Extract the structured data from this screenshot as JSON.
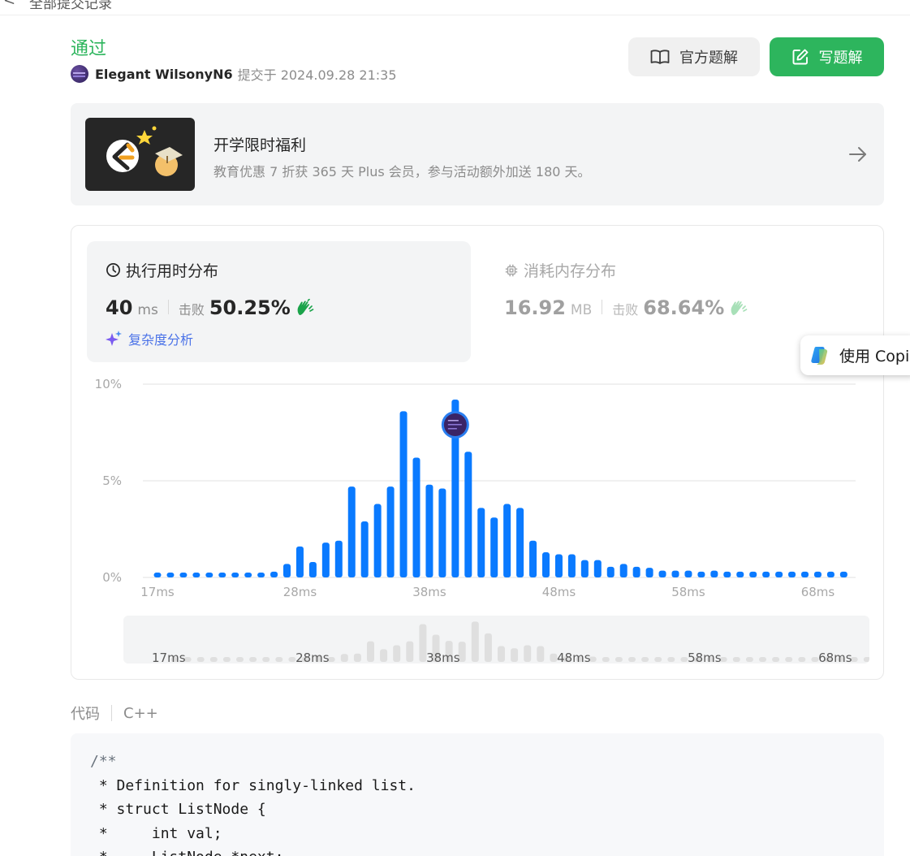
{
  "nav": {
    "back_label": "<",
    "breadcrumb": "全部提交记录"
  },
  "submission": {
    "status": "通过",
    "user": "Elegant WilsonyN6",
    "meta": "提交于 2024.09.28 21:35"
  },
  "actions": {
    "official_solution": "官方题解",
    "write_solution": "写题解"
  },
  "promo": {
    "title": "开学限时福利",
    "description": "教育优惠 7 折获 365 天 Plus 会员，参与活动额外加送 180 天。"
  },
  "runtime": {
    "title": "执行用时分布",
    "value": "40",
    "unit": "ms",
    "beat_label": "击败",
    "percent": "50.25%",
    "complexity_link": "复杂度分析"
  },
  "memory": {
    "title": "消耗内存分布",
    "value": "16.92",
    "unit": "MB",
    "beat_label": "击败",
    "percent": "68.64%"
  },
  "chart_data": {
    "type": "bar",
    "title": "执行用时分布",
    "xlabel": "",
    "ylabel": "",
    "ylim": [
      0,
      10
    ],
    "y_ticks": [
      "0%",
      "5%",
      "10%"
    ],
    "x_ticks": [
      "17ms",
      "28ms",
      "38ms",
      "48ms",
      "58ms",
      "68ms"
    ],
    "x": [
      17,
      18,
      19,
      20,
      21,
      22,
      23,
      24,
      25,
      26,
      27,
      28,
      29,
      30,
      31,
      32,
      33,
      34,
      35,
      36,
      37,
      38,
      39,
      40,
      41,
      42,
      43,
      44,
      45,
      46,
      47,
      48,
      49,
      50,
      51,
      52,
      53,
      54,
      55,
      56,
      57,
      58,
      59,
      60,
      61,
      62,
      63,
      64,
      65,
      66,
      67,
      68,
      69,
      70
    ],
    "values": [
      0.25,
      0.25,
      0.25,
      0.25,
      0.25,
      0.25,
      0.25,
      0.25,
      0.25,
      0.3,
      0.7,
      1.6,
      0.8,
      1.8,
      1.9,
      4.7,
      2.9,
      3.8,
      4.7,
      8.6,
      6.2,
      4.8,
      4.6,
      9.2,
      6.5,
      3.6,
      3.1,
      3.8,
      3.6,
      1.9,
      1.3,
      1.2,
      1.2,
      0.9,
      0.9,
      0.55,
      0.7,
      0.55,
      0.5,
      0.35,
      0.35,
      0.35,
      0.3,
      0.35,
      0.3,
      0.3,
      0.3,
      0.3,
      0.3,
      0.3,
      0.3,
      0.3,
      0.3,
      0.3
    ],
    "highlight_x": 40,
    "grid": true
  },
  "copilot": {
    "label": "使用 Copilot"
  },
  "code": {
    "label": "代码",
    "language": "C++",
    "lines": [
      "/**",
      " * Definition for singly-linked list.",
      " * struct ListNode {",
      " *     int val;",
      " *     ListNode *next;"
    ]
  },
  "colors": {
    "accent_green": "#2db55d",
    "bar_blue": "#0a7aff",
    "link_blue": "#4a72e8"
  }
}
